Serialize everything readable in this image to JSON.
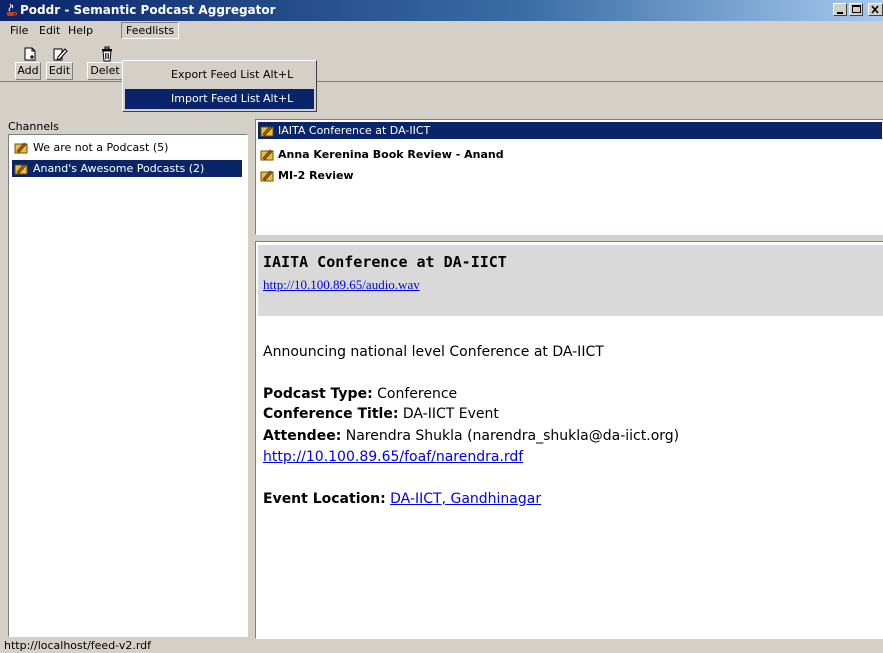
{
  "window": {
    "title": "Poddr - Semantic Podcast Aggregator",
    "title_bar_color": "#0a246a"
  },
  "menubar": {
    "items": [
      "File",
      "Edit",
      "Help",
      "Feedlists"
    ],
    "active": "Feedlists"
  },
  "toolbar": {
    "add_label": "Add",
    "edit_label": "Edit",
    "delete_label": "Delet"
  },
  "feedlists_menu": {
    "items": [
      {
        "label": "Export Feed List",
        "accelerator": "Alt+L"
      },
      {
        "label": "Import Feed List",
        "accelerator": "Alt+L"
      }
    ],
    "highlighted": "Import Feed List"
  },
  "channels": {
    "header": "Channels",
    "items": [
      {
        "label": "We are not a Podcast (5)",
        "selected": false
      },
      {
        "label": "Anand's Awesome Podcasts (2)",
        "selected": true
      }
    ]
  },
  "episodes": {
    "items": [
      {
        "label": "IAITA Conference at DA-IICT",
        "selected": true,
        "bold": false
      },
      {
        "label": "Anna Kerenina Book Review - Anand",
        "selected": false,
        "bold": true
      },
      {
        "label": "MI-2 Review",
        "selected": false,
        "bold": true
      }
    ]
  },
  "details": {
    "title": "IAITA Conference at DA-IICT",
    "audio_url": "http://10.100.89.65/audio.wav",
    "description": "Announcing national level Conference at DA-IICT",
    "podcast_type_label": "Podcast Type:",
    "podcast_type_value": "Conference",
    "conference_title_label": "Conference Title:",
    "conference_title_value": "DA-IICT Event",
    "attendee_label": "Attendee:",
    "attendee_value": "Narendra Shukla (narendra_shukla@da-iict.org)",
    "attendee_foaf_url": "http://10.100.89.65/foaf/narendra.rdf",
    "event_location_label": "Event Location:",
    "event_location_value": "DA-IICT, Gandhinagar"
  },
  "statusbar": {
    "text": "http://localhost/feed-v2.rdf"
  },
  "colors": {
    "selection": "#0a246a",
    "link": "#0000ee",
    "chrome": "#d4d0c8"
  }
}
